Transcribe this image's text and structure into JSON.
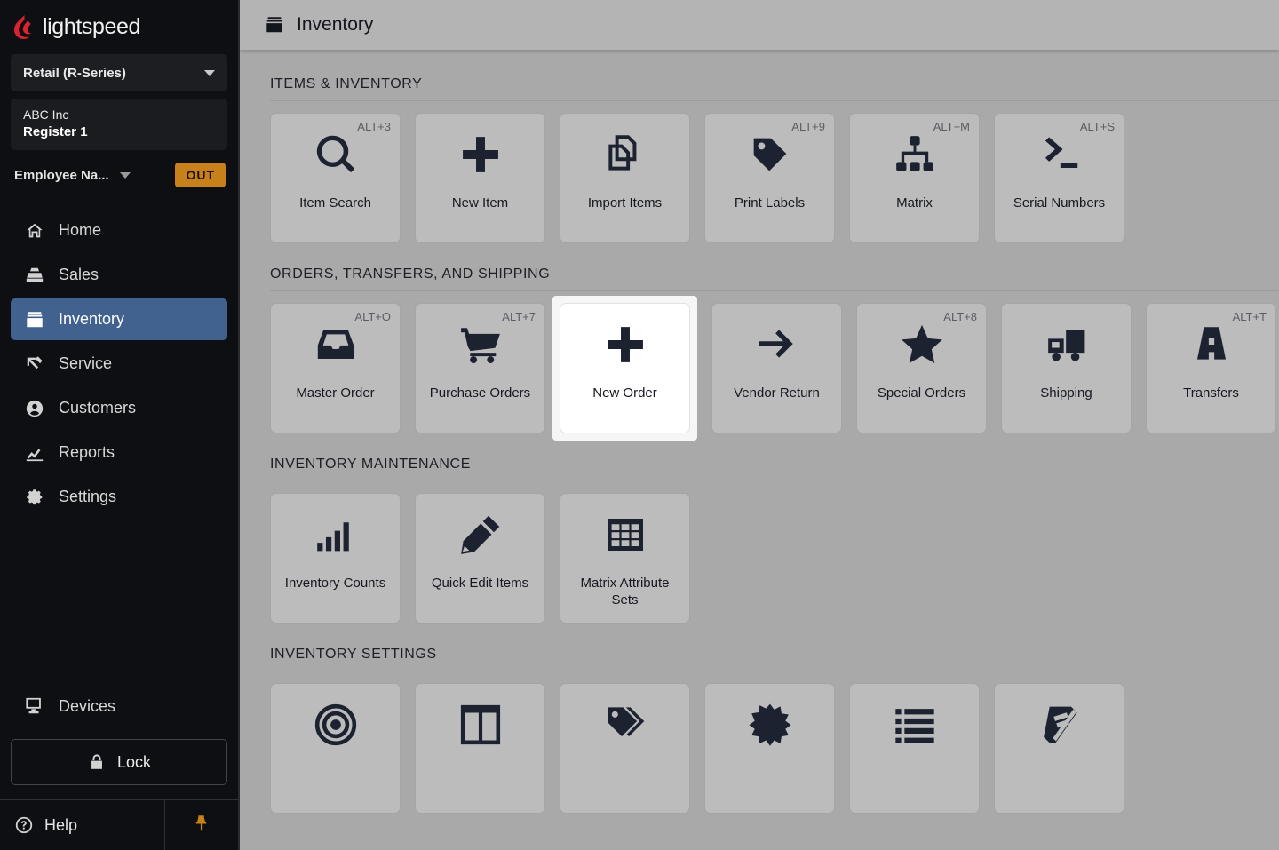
{
  "sidebar": {
    "brand": "lightspeed",
    "series_selector": {
      "label": "Retail (R-Series)",
      "icon": "chevron-down-icon"
    },
    "store": {
      "company": "ABC Inc",
      "register": "Register 1"
    },
    "employee": {
      "name": "Employee Na...",
      "status_badge": "OUT"
    },
    "nav": [
      {
        "label": "Home",
        "icon": "home-icon",
        "active": false
      },
      {
        "label": "Sales",
        "icon": "register-icon",
        "active": false
      },
      {
        "label": "Inventory",
        "icon": "inventory-box-icon",
        "active": true
      },
      {
        "label": "Service",
        "icon": "hammer-icon",
        "active": false
      },
      {
        "label": "Customers",
        "icon": "person-circle-icon",
        "active": false
      },
      {
        "label": "Reports",
        "icon": "chart-line-icon",
        "active": false
      },
      {
        "label": "Settings",
        "icon": "gear-icon",
        "active": false
      }
    ],
    "devices": {
      "label": "Devices",
      "icon": "monitor-icon"
    },
    "lock": {
      "label": "Lock",
      "icon": "lock-icon"
    },
    "help": {
      "label": "Help",
      "icon": "question-circle-icon"
    },
    "pin": {
      "icon": "pushpin-icon"
    }
  },
  "topbar": {
    "title": "Inventory",
    "icon": "inventory-box-icon"
  },
  "sections": [
    {
      "title": "ITEMS & INVENTORY",
      "tiles": [
        {
          "label": "Item Search",
          "shortcut": "ALT+3",
          "icon": "magnifier-icon"
        },
        {
          "label": "New Item",
          "shortcut": "",
          "icon": "plus-icon"
        },
        {
          "label": "Import Items",
          "shortcut": "",
          "icon": "copy-documents-icon"
        },
        {
          "label": "Print Labels",
          "shortcut": "ALT+9",
          "icon": "price-tag-icon"
        },
        {
          "label": "Matrix",
          "shortcut": "ALT+M",
          "icon": "sitemap-icon"
        },
        {
          "label": "Serial Numbers",
          "shortcut": "ALT+S",
          "icon": "terminal-prompt-icon"
        }
      ]
    },
    {
      "title": "ORDERS, TRANSFERS, AND SHIPPING",
      "tiles": [
        {
          "label": "Master Order",
          "shortcut": "ALT+O",
          "icon": "inbox-tray-icon"
        },
        {
          "label": "Purchase Orders",
          "shortcut": "ALT+7",
          "icon": "shopping-cart-icon"
        },
        {
          "label": "New Order",
          "shortcut": "",
          "icon": "plus-icon",
          "focused": true
        },
        {
          "label": "Vendor Return",
          "shortcut": "",
          "icon": "arrow-right-icon"
        },
        {
          "label": "Special Orders",
          "shortcut": "ALT+8",
          "icon": "star-icon"
        },
        {
          "label": "Shipping",
          "shortcut": "",
          "icon": "delivery-truck-icon"
        },
        {
          "label": "Transfers",
          "shortcut": "ALT+T",
          "icon": "road-icon"
        }
      ]
    },
    {
      "title": "INVENTORY MAINTENANCE",
      "tiles": [
        {
          "label": "Inventory Counts",
          "shortcut": "",
          "icon": "bar-chart-icon"
        },
        {
          "label": "Quick Edit Items",
          "shortcut": "",
          "icon": "pencil-icon"
        },
        {
          "label": "Matrix Attribute Sets",
          "shortcut": "",
          "icon": "grid-table-icon"
        }
      ]
    },
    {
      "title": "INVENTORY SETTINGS",
      "tiles": [
        {
          "label": "",
          "shortcut": "",
          "icon": "target-icon"
        },
        {
          "label": "",
          "shortcut": "",
          "icon": "columns-icon"
        },
        {
          "label": "",
          "shortcut": "",
          "icon": "tags-icon"
        },
        {
          "label": "",
          "shortcut": "",
          "icon": "burst-icon"
        },
        {
          "label": "",
          "shortcut": "",
          "icon": "bullet-list-icon"
        },
        {
          "label": "",
          "shortcut": "",
          "icon": "book-icon"
        }
      ]
    }
  ],
  "colors": {
    "accent": "#41618f",
    "badge": "#c8801a",
    "sidebar": "#0e0f13",
    "page": "#a9a9a9",
    "tile": "#bcbcbc"
  }
}
